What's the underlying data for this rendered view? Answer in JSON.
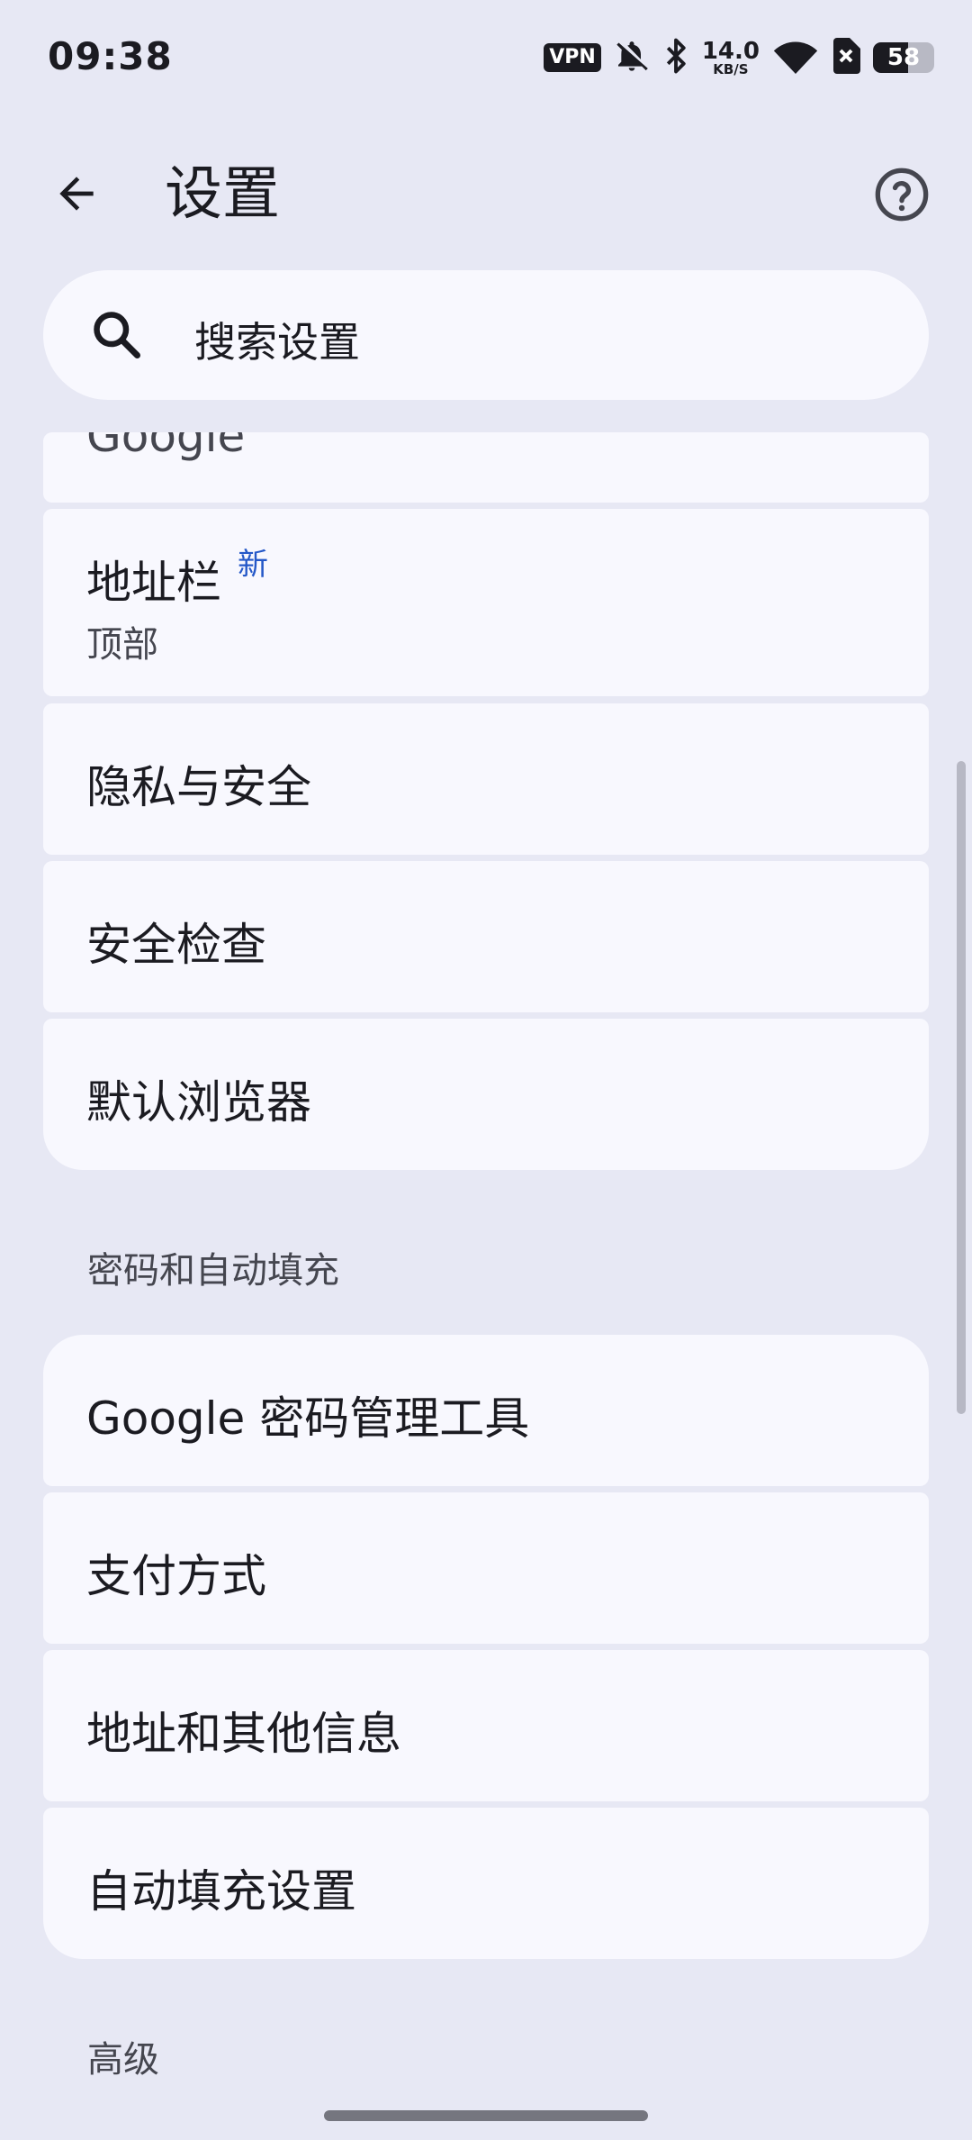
{
  "status_bar": {
    "time": "09:38",
    "vpn": "VPN",
    "speed_value": "14.0",
    "speed_unit": "KB/S",
    "battery_level": "58",
    "battery_fraction": 0.58,
    "icons": [
      "vpn-icon",
      "bell-off-icon",
      "bluetooth-icon",
      "wifi-icon",
      "sim-x-icon",
      "battery-icon"
    ]
  },
  "header": {
    "title": "设置",
    "back_icon": "arrow-left-icon",
    "help_icon": "help-circle-icon"
  },
  "search": {
    "placeholder": "搜索设置",
    "icon": "search-icon"
  },
  "basics": {
    "items": [
      {
        "title": "Google"
      },
      {
        "title": "地址栏",
        "badge": "新",
        "subtitle": "顶部"
      },
      {
        "title": "隐私与安全"
      },
      {
        "title": "安全检查"
      },
      {
        "title": "默认浏览器"
      }
    ]
  },
  "passwords_section": {
    "header": "密码和自动填充",
    "items": [
      {
        "title": "Google 密码管理工具"
      },
      {
        "title": "支付方式"
      },
      {
        "title": "地址和其他信息"
      },
      {
        "title": "自动填充设置"
      }
    ]
  },
  "advanced_section": {
    "header": "高级"
  },
  "colors": {
    "background": "#e7e8f4",
    "card": "#f8f8fe",
    "accent": "#2458c8",
    "text": "#1b1b21"
  }
}
